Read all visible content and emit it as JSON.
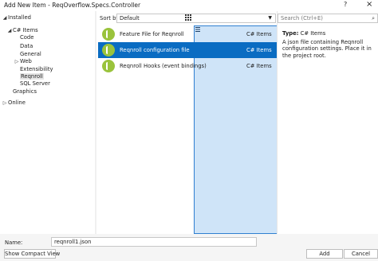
{
  "window": {
    "title": "Add New Item - ReqOverflow.Specs.Controller",
    "help_glyph": "?",
    "close_glyph": "×"
  },
  "tree": {
    "installed": "Installed",
    "csharp_items": "C# Items",
    "children": [
      "Code",
      "Data",
      "General",
      "Web",
      "Extensibility",
      "Reqnroll",
      "SQL Server"
    ],
    "graphics": "Graphics",
    "online": "Online"
  },
  "toolbar": {
    "sort_label": "Sort by:",
    "sort_value": "Default"
  },
  "templates": [
    {
      "name": "Feature File for Reqnroll",
      "lang": "C# Items",
      "icon": "reqnroll-logo-icon"
    },
    {
      "name": "Reqnroll configuration file",
      "lang": "C# Items",
      "icon": "reqnroll-logo-icon"
    },
    {
      "name": "Reqnroll Hooks (event bindings)",
      "lang": "C# Items",
      "icon": "reqnroll-logo-icon"
    }
  ],
  "search": {
    "placeholder": "Search (Ctrl+E)"
  },
  "details": {
    "type_label": "Type:",
    "type_value": "C# Items",
    "description": "A json file containing Reqnroll configuration settings. Place it in the project root."
  },
  "bottom": {
    "name_label": "Name:",
    "name_value": "reqnroll1.json",
    "compact_label": "Show Compact View",
    "add_label": "Add",
    "cancel_label": "Cancel"
  },
  "colors": {
    "selection": "#0a6cc2",
    "logo": "#9ac33c"
  }
}
